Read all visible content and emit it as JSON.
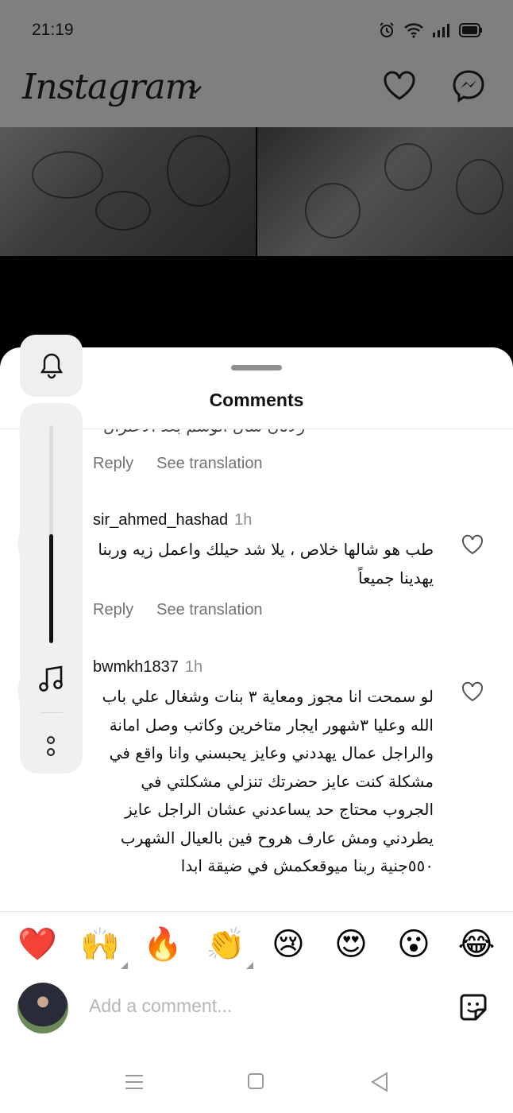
{
  "status_bar": {
    "time": "21:19",
    "icons": [
      "alarm-icon",
      "wifi-icon",
      "signal-icon",
      "battery-icon"
    ]
  },
  "header": {
    "logo": "Instagram",
    "icons": [
      "chevron-down-icon",
      "heart-icon",
      "messenger-icon"
    ]
  },
  "sheet": {
    "title": "Comments"
  },
  "comments": [
    {
      "username": "",
      "time": "",
      "text_partial": "رلانان سال الوسم بعد الاعتزال",
      "reply_label": "Reply",
      "translate_label": "See translation"
    },
    {
      "username": "sir_ahmed_hashad",
      "time": "1h",
      "text": "طب هو شالها خلاص ، يلا شد حيلك واعمل زيه وربنا يهدينا جميعاً",
      "reply_label": "Reply",
      "translate_label": "See translation"
    },
    {
      "username": "bwmkh1837",
      "time": "1h",
      "text": "لو سمحت انا مجوز ومعاية ٣ بنات وشغال علي باب الله وعليا ٣شهور ايجار متاخرين وكاتب وصل امانة والراجل عمال يهددني وعايز يحبسني وانا واقع في مشكلة كنت عايز حضرتك تنزلي مشكلتي في الجروب محتاج حد يساعدني عشان الراجل عايز يطردني ومش عارف هروح فين بالعيال الشهرب ٥٥٠جنية ربنا ميوقعكمش في ضيقة ابدا"
    }
  ],
  "volume_panel": {
    "level_fraction": 0.5,
    "icons": [
      "bell-icon",
      "music-note-icon",
      "more-icon"
    ]
  },
  "reactions": [
    {
      "emoji": "❤️",
      "name": "red-heart"
    },
    {
      "emoji": "🙌",
      "name": "raising-hands",
      "has_variants": true
    },
    {
      "emoji": "🔥",
      "name": "fire"
    },
    {
      "emoji": "👏",
      "name": "clapping-hands",
      "has_variants": true
    },
    {
      "emoji": "😢",
      "name": "crying-face"
    },
    {
      "emoji": "😍",
      "name": "heart-eyes"
    },
    {
      "emoji": "😮",
      "name": "surprised-face"
    },
    {
      "emoji": "😂",
      "name": "tears-of-joy"
    }
  ],
  "composer": {
    "placeholder": "Add a comment..."
  },
  "colors": {
    "link_gray": "#737373",
    "heart_red": "#e0202b"
  }
}
